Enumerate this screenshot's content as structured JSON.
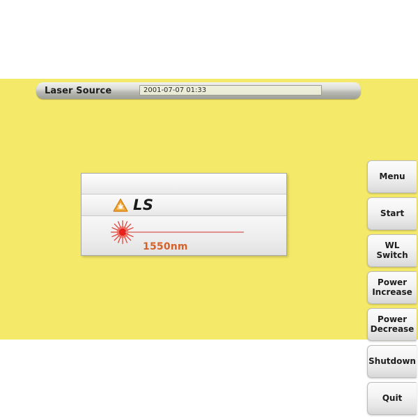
{
  "app": {
    "title_bar": {
      "label": "Laser Source",
      "datetime": "2001-07-07 01:33",
      "datetime_placeholder": "YYYY-MM-DD hh:mm"
    },
    "background_color": "#f5e969"
  },
  "panel": {
    "module_label": "LS",
    "wavelength": "1550nm",
    "warning_icon_name": "laser-radiation-warning-icon",
    "laser_icon_name": "laser-burst-icon",
    "beam_color": "#e08e8e",
    "wavelength_color": "#d4622c",
    "warning_icon_color": "#e8932a"
  },
  "buttons": [
    {
      "id": "menu",
      "label": "Menu"
    },
    {
      "id": "start",
      "label": "Start"
    },
    {
      "id": "wl-switch",
      "label": "WL Switch"
    },
    {
      "id": "power-increase",
      "label": "Power\nIncrease"
    },
    {
      "id": "power-decrease",
      "label": "Power\nDecrease"
    },
    {
      "id": "shutdown",
      "label": "Shutdown"
    },
    {
      "id": "quit",
      "label": "Quit"
    }
  ]
}
